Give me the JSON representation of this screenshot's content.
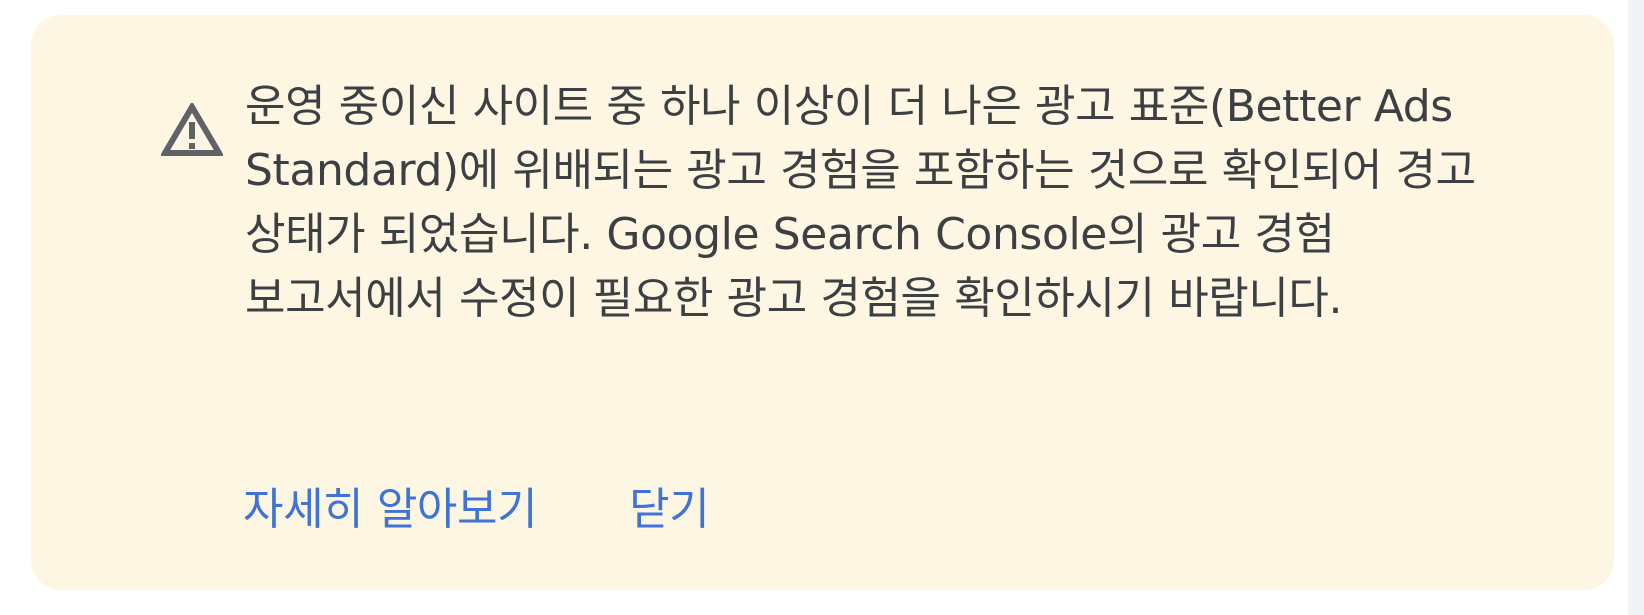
{
  "banner": {
    "icon": "warning-triangle-icon",
    "message": "운영 중이신 사이트 중 하나 이상이 더 나은 광고 표준(Better Ads Standard)에 위배되는 광고 경험을 포함하는 것으로 확인되어 경고 상태가 되었습니다. Google Search Console의 광고 경험 보고서에서 수정이 필요한 광고 경험을 확인하시기 바랍니다.",
    "learn_more_label": "자세히 알아보기",
    "dismiss_label": "닫기",
    "colors": {
      "background": "#fcf6e3",
      "text": "#3c4043",
      "link": "#3f73d8",
      "icon": "#5f6368"
    }
  }
}
